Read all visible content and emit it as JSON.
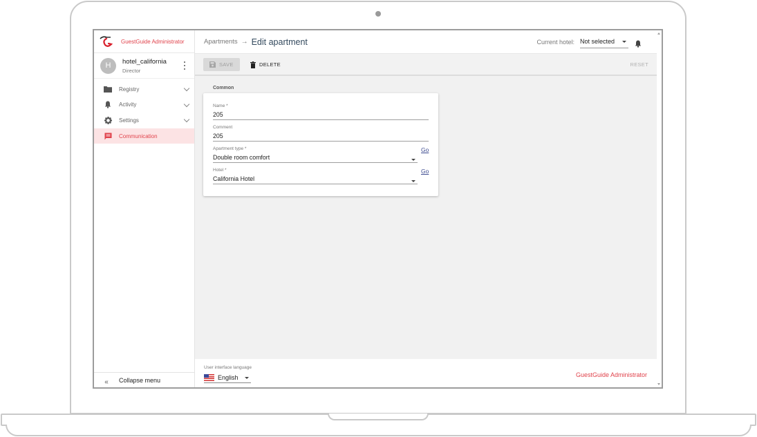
{
  "brand": {
    "name": "GuestGuide Administrator",
    "accent": "#e0424b"
  },
  "user": {
    "initial": "H",
    "name": "hotel_california",
    "role": "Director"
  },
  "sidebar": {
    "items": [
      {
        "label": "Registry",
        "icon": "folder-icon"
      },
      {
        "label": "Activity",
        "icon": "bell-icon"
      },
      {
        "label": "Settings",
        "icon": "gear-icon"
      },
      {
        "label": "Communication",
        "icon": "chat-icon",
        "active": true
      }
    ],
    "collapse_label": "Collapse menu",
    "collapse_icon": "«"
  },
  "header": {
    "breadcrumb": "Apartments",
    "arrow": "→",
    "title": "Edit apartment",
    "hotel_label": "Current hotel:",
    "hotel_value": "Not selected"
  },
  "toolbar": {
    "save_label": "SAVE",
    "delete_label": "DELETE",
    "reset_label": "RESET"
  },
  "form": {
    "section_title": "Common",
    "name_label": "Name *",
    "name_value": "205",
    "comment_label": "Comment",
    "comment_value": "205",
    "apartment_type_label": "Apartment type *",
    "apartment_type_value": "Double room comfort",
    "hotel_label": "Hotel *",
    "hotel_value": "California Hotel",
    "go_label": "Go"
  },
  "footer": {
    "language_label": "User interface language",
    "language_value": "English",
    "brand": "GuestGuide Administrator"
  }
}
